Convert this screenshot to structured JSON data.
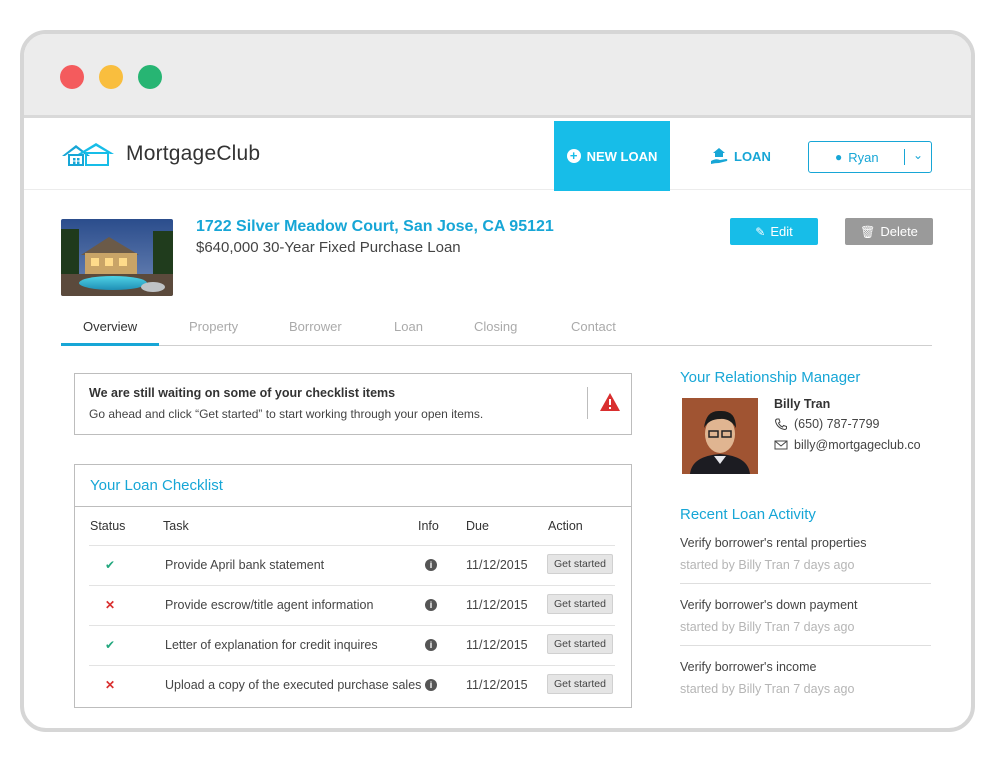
{
  "app": {
    "brand": "MortgageClub",
    "new_loan_label": "NEW LOAN",
    "loan_label": "LOAN",
    "user_name": "Ryan"
  },
  "loan": {
    "address": "1722 Silver Meadow Court, San Jose, CA 95121",
    "description": "$640,000 30-Year Fixed Purchase Loan",
    "edit_label": "Edit",
    "delete_label": "Delete"
  },
  "tabs": [
    {
      "label": "Overview",
      "active": true
    },
    {
      "label": "Property"
    },
    {
      "label": "Borrower"
    },
    {
      "label": "Loan"
    },
    {
      "label": "Closing"
    },
    {
      "label": "Contact"
    }
  ],
  "alert": {
    "title": "We are still waiting on some of your checklist items",
    "body": "Go ahead and click “Get started” to start working through your open items."
  },
  "checklist": {
    "title": "Your Loan Checklist",
    "headers": {
      "status": "Status",
      "task": "Task",
      "info": "Info",
      "due": "Due",
      "action": "Action"
    },
    "rows": [
      {
        "status": "done",
        "task": "Provide April bank statement",
        "due": "11/12/2015",
        "action": "Get started"
      },
      {
        "status": "missing",
        "task": "Provide escrow/title agent information",
        "due": "11/12/2015",
        "action": "Get started"
      },
      {
        "status": "done",
        "task": "Letter of explanation for credit inquires",
        "due": "11/12/2015",
        "action": "Get started"
      },
      {
        "status": "missing",
        "task": "Upload a copy of the executed purchase sales",
        "due": "11/12/2015",
        "action": "Get started"
      }
    ]
  },
  "manager": {
    "section_title": "Your Relationship Manager",
    "name": "Billy Tran",
    "phone": "(650) 787-7799",
    "email": "billy@mortgageclub.co"
  },
  "activity": {
    "section_title": "Recent Loan Activity",
    "items": [
      {
        "title": "Verify borrower's rental properties",
        "meta": "started by Billy Tran 7 days ago"
      },
      {
        "title": "Verify borrower's down payment",
        "meta": "started by Billy Tran 7 days ago"
      },
      {
        "title": "Verify borrower's income",
        "meta": "started by Billy Tran 7 days ago"
      }
    ]
  },
  "colors": {
    "accent": "#17bde8",
    "link": "#17a6d6",
    "success": "#22a77e",
    "danger": "#d92f2f"
  }
}
